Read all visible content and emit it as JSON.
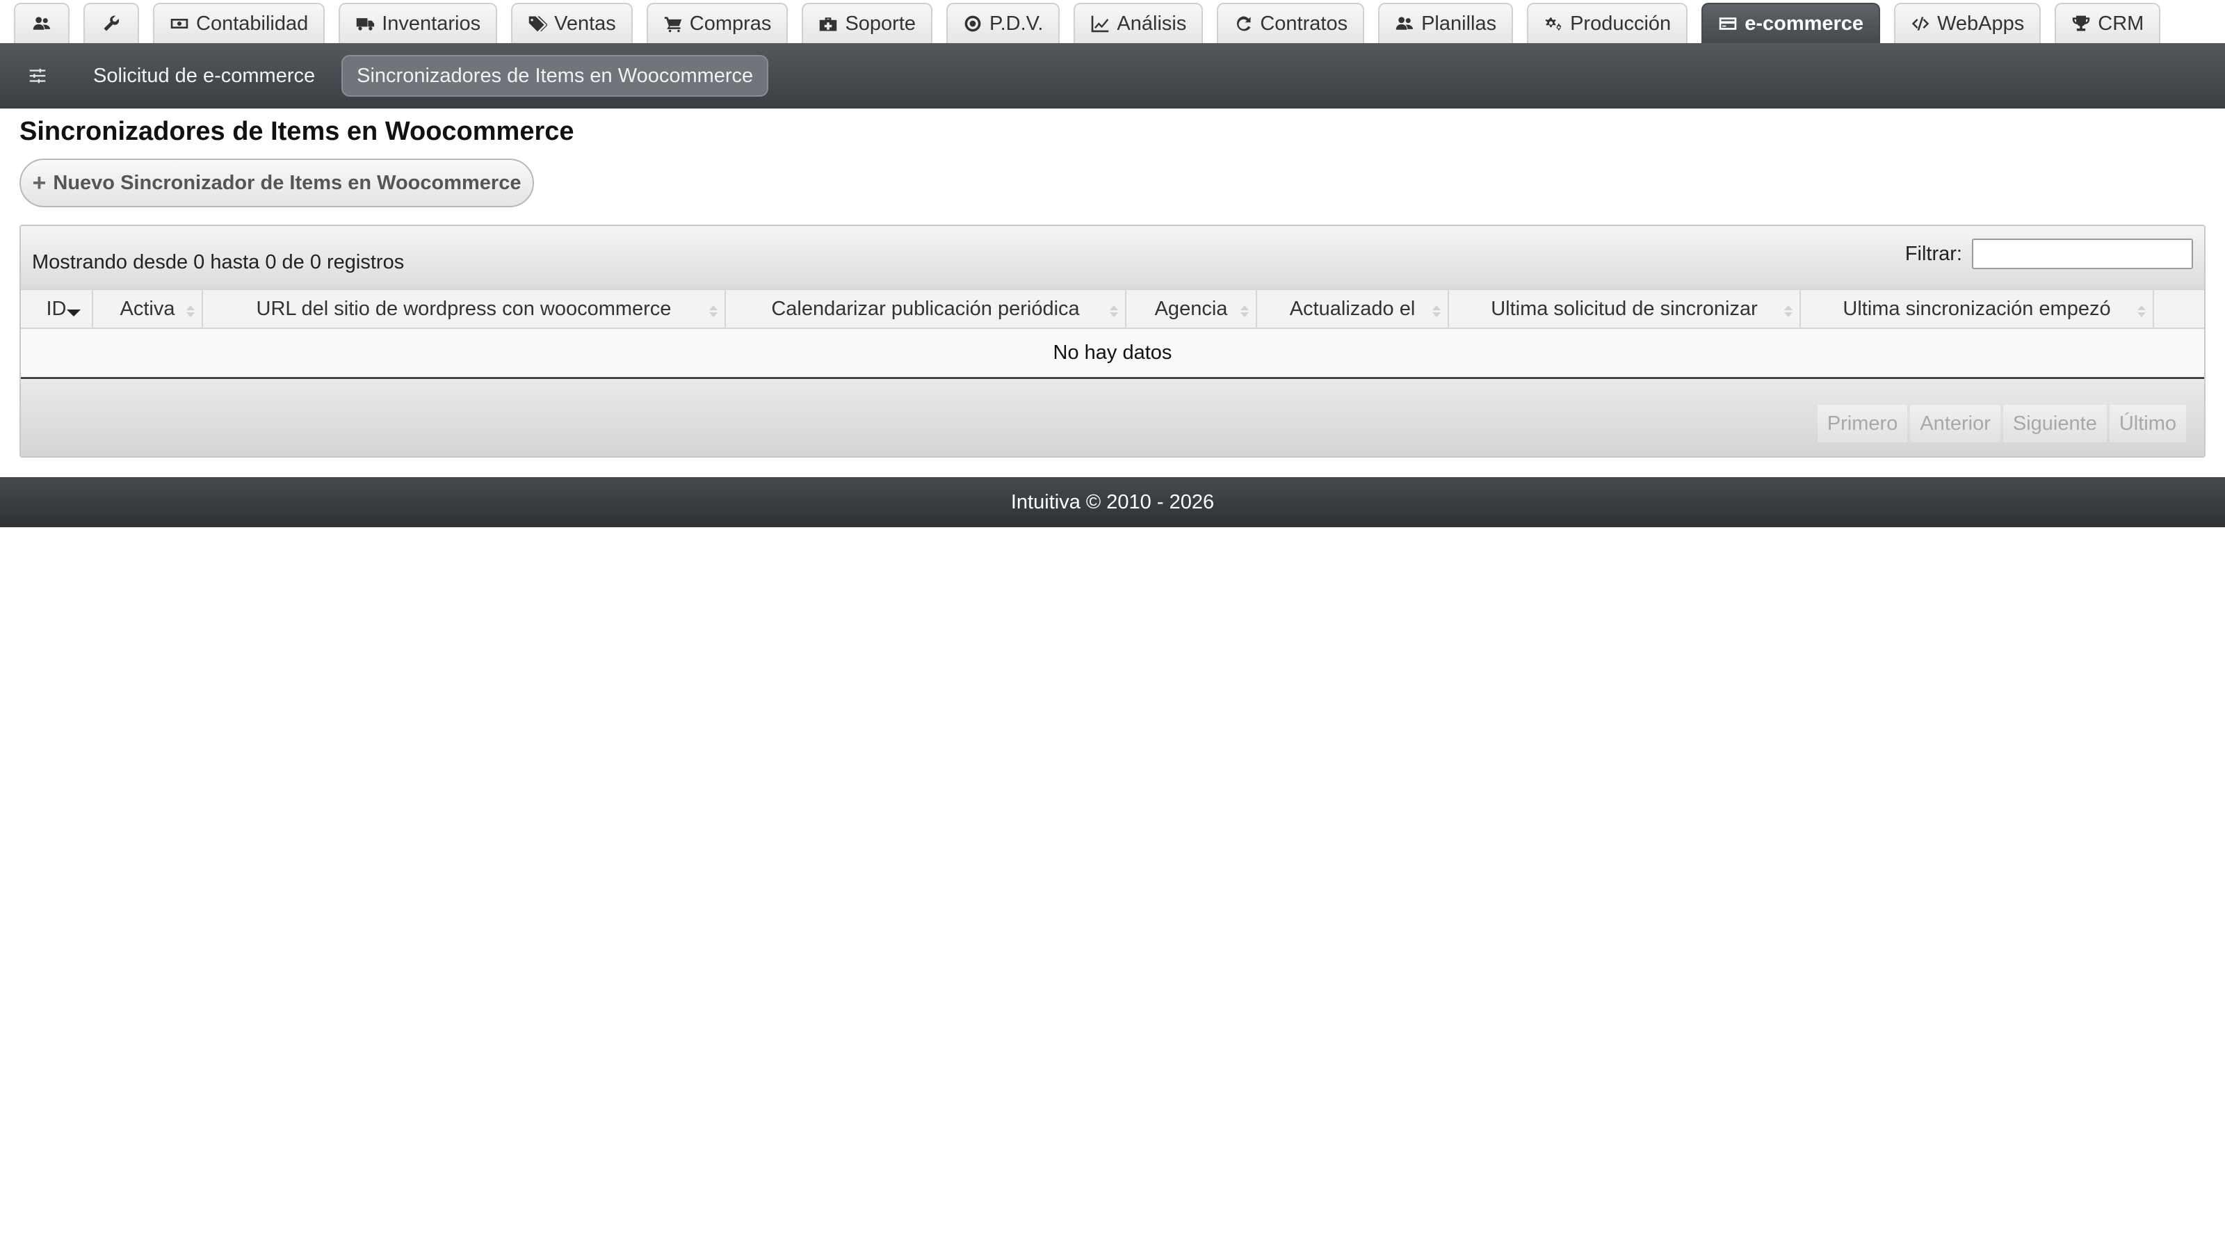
{
  "top_tabs": [
    {
      "label": "",
      "icon": "users-icon"
    },
    {
      "label": "",
      "icon": "wrench-icon"
    },
    {
      "label": "Contabilidad",
      "icon": "money-icon"
    },
    {
      "label": "Inventarios",
      "icon": "truck-icon"
    },
    {
      "label": "Ventas",
      "icon": "tags-icon"
    },
    {
      "label": "Compras",
      "icon": "cart-icon"
    },
    {
      "label": "Soporte",
      "icon": "medkit-icon"
    },
    {
      "label": "P.D.V.",
      "icon": "target-icon"
    },
    {
      "label": "Análisis",
      "icon": "chart-line-icon"
    },
    {
      "label": "Contratos",
      "icon": "refresh-icon"
    },
    {
      "label": "Planillas",
      "icon": "users-icon"
    },
    {
      "label": "Producción",
      "icon": "gears-icon"
    },
    {
      "label": "e-commerce",
      "icon": "credit-card-icon",
      "active": true
    },
    {
      "label": "WebApps",
      "icon": "code-icon"
    },
    {
      "label": "CRM",
      "icon": "trophy-icon"
    }
  ],
  "subnav": {
    "items": [
      {
        "label": "Solicitud de e-commerce"
      },
      {
        "label": "Sincronizadores de Items en Woocommerce",
        "active": true
      }
    ]
  },
  "page": {
    "title": "Sincronizadores de Items en Woocommerce",
    "new_button": "Nuevo Sincronizador de Items en Woocommerce"
  },
  "table": {
    "info": "Mostrando desde 0 hasta 0 de 0 registros",
    "filter_label": "Filtrar:",
    "filter_value": "",
    "columns": [
      "ID",
      "Activa",
      "URL del sitio de wordpress con woocommerce",
      "Calendarizar publicación periódica",
      "Agencia",
      "Actualizado el",
      "Ultima solicitud de sincronizar",
      "Ultima sincronización empezó"
    ],
    "empty_message": "No hay datos",
    "pagination": [
      "Primero",
      "Anterior",
      "Siguiente",
      "Último"
    ]
  },
  "footer": {
    "text": "Intuitiva © 2010 - 2026"
  },
  "colors": {
    "active_tab": "#44494d",
    "subnav_bg": "#3a3e42",
    "footer_bg": "#2f3235"
  }
}
